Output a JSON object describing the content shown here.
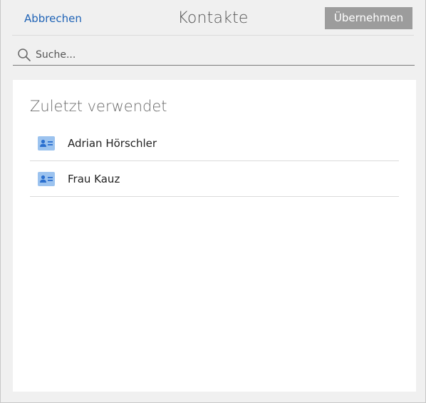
{
  "header": {
    "cancel_label": "Abbrechen",
    "title": "Kontakte",
    "apply_label": "Übernehmen"
  },
  "search": {
    "placeholder": "Suche...",
    "icon": "search-icon"
  },
  "recent": {
    "section_title": "Zuletzt verwendet",
    "contacts": [
      {
        "name": "Adrian Hörschler",
        "icon": "contact-card-icon"
      },
      {
        "name": "Frau Kauz",
        "icon": "contact-card-icon"
      }
    ]
  },
  "colors": {
    "link": "#1f63b6",
    "apply_button_bg": "#9c9c9c",
    "contact_icon": "#5b9be0"
  }
}
